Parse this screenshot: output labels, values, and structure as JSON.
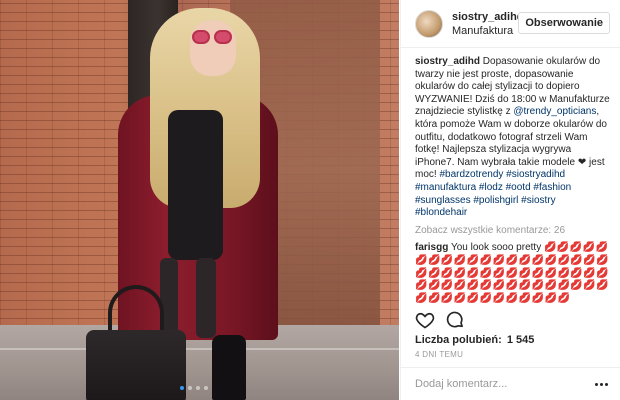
{
  "post": {
    "username": "siostry_adihd",
    "location": "Manufaktura",
    "follow_label": "Obserwowanie"
  },
  "caption": {
    "username": "siostry_adihd",
    "text_1": " Dopasowanie okularów do twarzy nie jest proste, dopasowanie okularów do całej stylizacji to dopiero WYZWANIE! Dziś do 18:00 w Manufakturze znajdziecie stylistkę z ",
    "mention": "@trendy_opticians",
    "text_2": ", która pomoże Wam w doborze okularów do outfitu, dodatkowo fotograf strzeli Wam fotkę! Najlepsza stylizacja wygrywa iPhone7. Nam wybrała takie modele ",
    "heart": "❤",
    "text_3": " jest moc! ",
    "hashtags": "#bardzotrendy #siostryadihd #manufaktura #lodz #ootd #fashion #sunglasses #polishgirl #siostry #blondehair"
  },
  "view_all_comments": "Zobacz wszystkie komentarze: 26",
  "comment": {
    "username": "farisgg",
    "text": " You look sooo pretty ",
    "emojis": "💋💋💋💋💋💋💋💋💋💋💋💋💋💋💋💋💋💋💋💋💋💋💋💋💋💋💋💋💋💋💋💋💋💋💋💋💋💋💋💋💋💋💋💋💋💋💋💋💋💋💋💋💋💋💋💋💋💋💋💋💋💋"
  },
  "likes": {
    "label": "Liczba polubień:",
    "count": "1 545"
  },
  "age": "4 DNI TEMU",
  "add_comment_placeholder": "Dodaj komentarz...",
  "colors": {
    "link": "#003569",
    "carousel_active": "#3897f0",
    "muted": "#999999"
  },
  "icons": [
    "heart-outline-icon",
    "comment-bubble-icon",
    "more-options-icon"
  ]
}
